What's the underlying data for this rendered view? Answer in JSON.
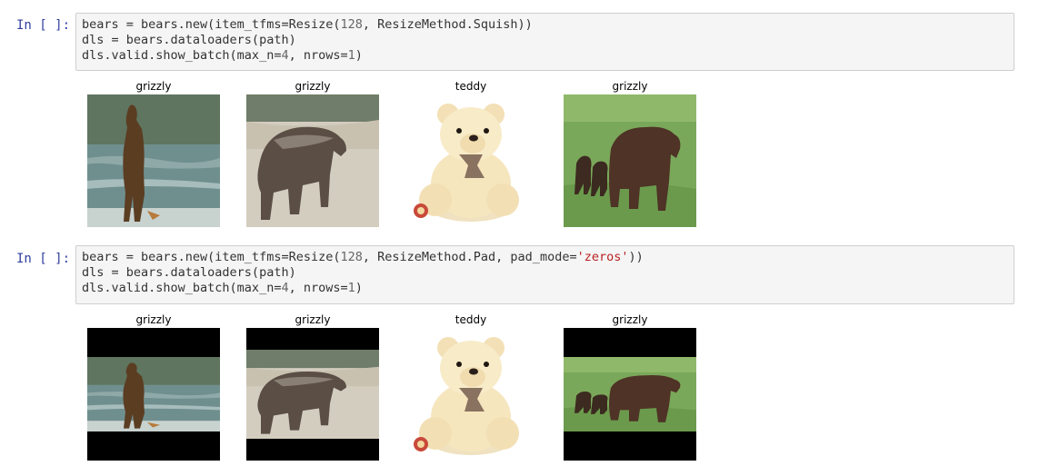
{
  "cells": [
    {
      "prompt": "In [ ]:",
      "code": [
        [
          {
            "t": "bears = bears.new(item_tfms=Resize(",
            "c": "op"
          },
          {
            "t": "128",
            "c": "num"
          },
          {
            "t": ", ResizeMethod.Squish))",
            "c": "op"
          }
        ],
        [
          {
            "t": "dls = bears.dataloaders(path)",
            "c": "op"
          }
        ],
        [
          {
            "t": "dls.valid.show_batch(max_n=",
            "c": "op"
          },
          {
            "t": "4",
            "c": "num"
          },
          {
            "t": ", nrows=",
            "c": "op"
          },
          {
            "t": "1",
            "c": "num"
          },
          {
            "t": ")",
            "c": "op"
          }
        ]
      ],
      "outputs": [
        {
          "label": "grizzly",
          "image": "standing-bear-in-water"
        },
        {
          "label": "grizzly",
          "image": "walking-grizzly"
        },
        {
          "label": "teddy",
          "image": "teddy-bear"
        },
        {
          "label": "grizzly",
          "image": "bear-with-cubs-on-grass"
        }
      ]
    },
    {
      "prompt": "In [ ]:",
      "code": [
        [
          {
            "t": "bears = bears.new(item_tfms=Resize(",
            "c": "op"
          },
          {
            "t": "128",
            "c": "num"
          },
          {
            "t": ", ResizeMethod.Pad, pad_mode=",
            "c": "op"
          },
          {
            "t": "'zeros'",
            "c": "str"
          },
          {
            "t": "))",
            "c": "op"
          }
        ],
        [
          {
            "t": "dls = bears.dataloaders(path)",
            "c": "op"
          }
        ],
        [
          {
            "t": "dls.valid.show_batch(max_n=",
            "c": "op"
          },
          {
            "t": "4",
            "c": "num"
          },
          {
            "t": ", nrows=",
            "c": "op"
          },
          {
            "t": "1",
            "c": "num"
          },
          {
            "t": ")",
            "c": "op"
          }
        ]
      ],
      "outputs": [
        {
          "label": "grizzly",
          "image": "standing-bear-in-water",
          "padded": true
        },
        {
          "label": "grizzly",
          "image": "walking-grizzly",
          "padded": true
        },
        {
          "label": "teddy",
          "image": "teddy-bear"
        },
        {
          "label": "grizzly",
          "image": "bear-with-cubs-on-grass",
          "padded": true
        }
      ]
    }
  ]
}
